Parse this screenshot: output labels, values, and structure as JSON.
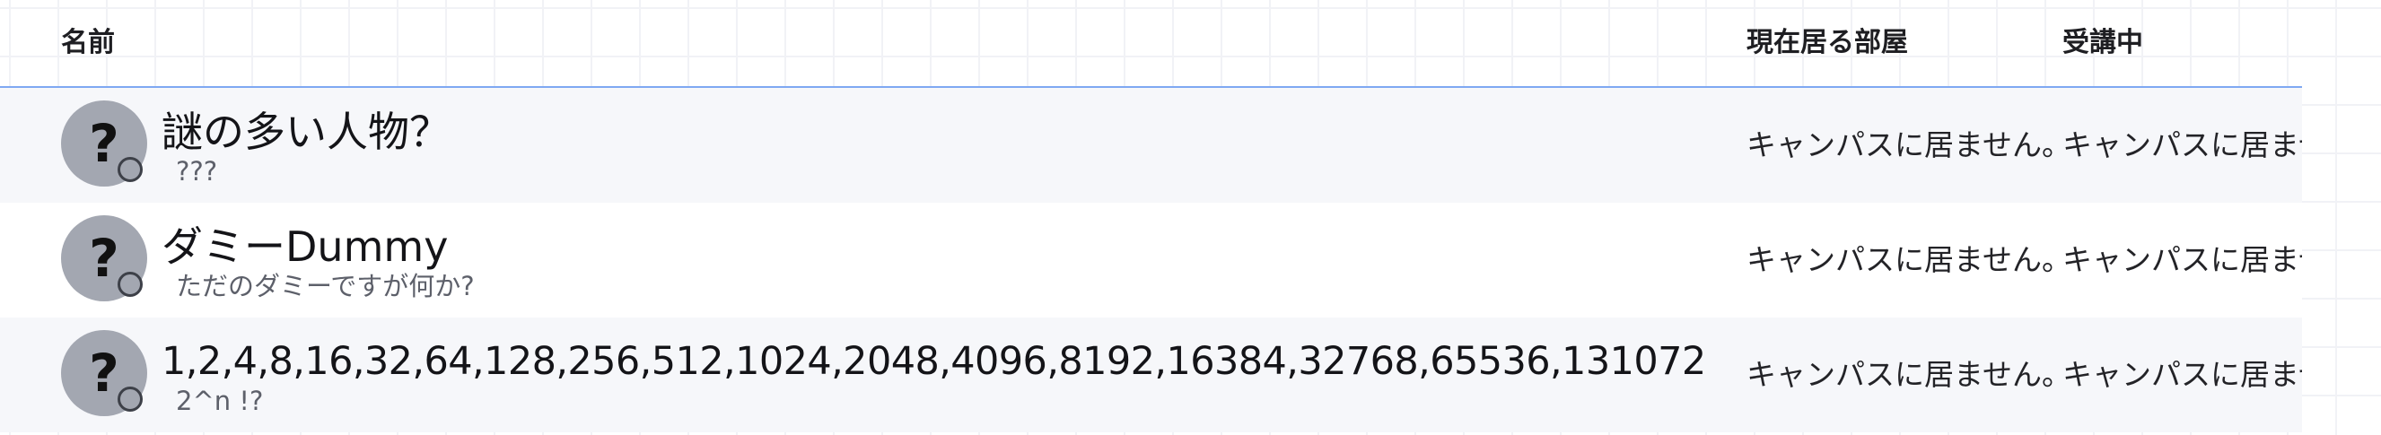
{
  "header": {
    "col_name": "名前",
    "col_room": "現在居る部屋",
    "col_class": "受講中"
  },
  "rows": [
    {
      "avatar_glyph": "?",
      "name": "謎の多い人物？",
      "subtitle": "???",
      "room": "キャンパスに居ません。",
      "class": "キャンパスに居ません。"
    },
    {
      "avatar_glyph": "?",
      "name": "ダミーDummy",
      "subtitle": "ただのダミーですが何か?",
      "room": "キャンパスに居ません。",
      "class": "キャンパスに居ません。"
    },
    {
      "avatar_glyph": "?",
      "name": "1,2,4,8,16,32,64,128,256,512,1024,2048,4096,8192,16384,32768,65536,131072",
      "subtitle": "2^n !?",
      "room": "キャンパスに居ません。",
      "class": "キャンパスに居ません。"
    }
  ]
}
